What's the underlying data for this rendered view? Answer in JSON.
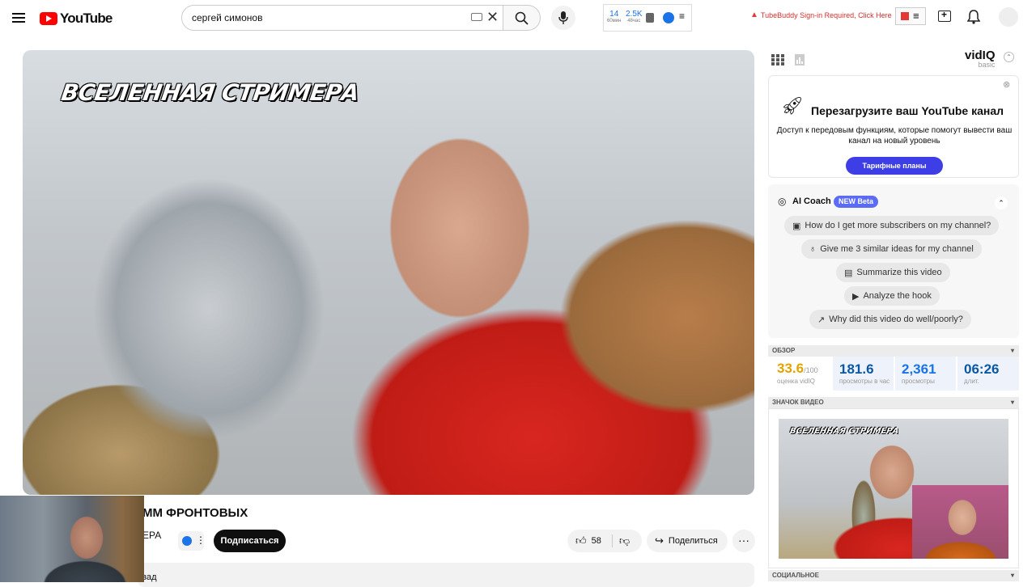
{
  "header": {
    "logo_text": "YouTube",
    "search_value": "сергей симонов",
    "tb_stats": [
      {
        "value": "14",
        "sub": "60мин"
      },
      {
        "value": "2.5K",
        "sub": "48час"
      }
    ],
    "tubebuddy_warning": "TubeBuddy Sign-in Required, Click Here"
  },
  "video": {
    "overlay_title": "ВСЕЛЕННАЯ СТРИМЕРА",
    "title_partial": "ММ ФРОНТОВЫХ",
    "channel_partial": "ЕРА",
    "subscribe_label": "Подписаться",
    "likes": "58",
    "share_label": "Поделиться",
    "description_partial": "зад"
  },
  "vidiq": {
    "logo": "vidIQ",
    "logo_sub": "basic",
    "promo": {
      "title": "Перезагрузите ваш YouTube канал",
      "text": "Доступ к передовым функциям, которые помогут вывести ваш канал на новый уровень",
      "button": "Тарифные планы"
    },
    "coach": {
      "title": "AI Coach",
      "badge": "NEW Beta",
      "questions": [
        "How do I get more subscribers on my channel?",
        "Give me 3 similar ideas for my channel",
        "Summarize this video",
        "Analyze the hook",
        "Why did this video do well/poorly?"
      ]
    },
    "overview": {
      "header": "ОБЗОР",
      "score": "33.6",
      "score_max": "/100",
      "score_label": "оценка vidIQ",
      "views_per_hour": "181.6",
      "views_per_hour_label": "просмотры в час",
      "views": "2,361",
      "views_label": "просмотры",
      "duration": "06:26",
      "duration_label": "длит."
    },
    "thumbnail_header": "ЗНАЧОК ВИДЕО",
    "thumbnail_overlay": "ВСЕЛЕННАЯ СТРИМЕРА",
    "social_header": "СОЦИАЛЬНОЕ"
  },
  "colors": {
    "accent_blue": "#1a73e8",
    "promo_button": "#3d3ee6",
    "yt_red": "#ff0000",
    "score_color": "#e0a400"
  }
}
